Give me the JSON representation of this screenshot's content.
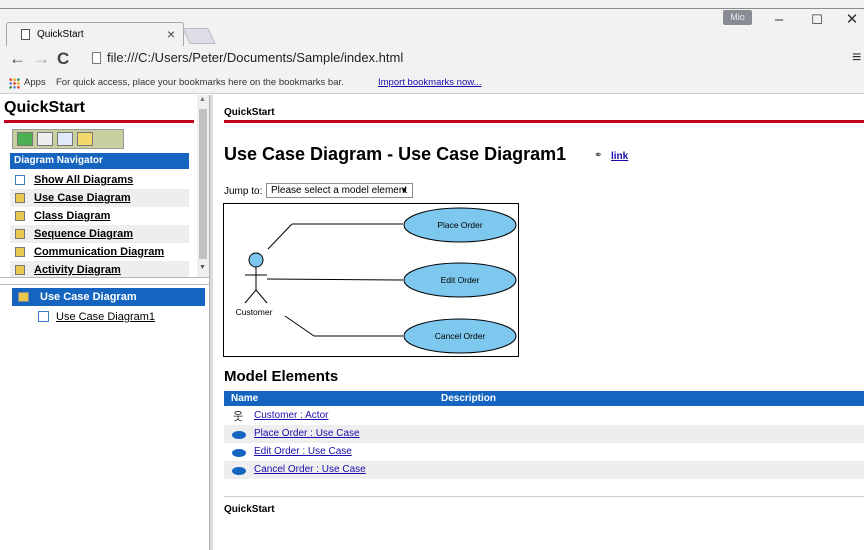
{
  "browser": {
    "tab_title": "QuickStart",
    "profile": "Mio",
    "url": "file:///C:/Users/Peter/Documents/Sample/index.html",
    "bookmarks": {
      "apps": "Apps",
      "info": "For quick access, place your bookmarks here on the bookmarks bar.",
      "import": "Import bookmarks now..."
    }
  },
  "sidebar": {
    "title": "QuickStart",
    "navigator": {
      "heading": "Diagram Navigator",
      "items": [
        {
          "label": "Show All Diagrams",
          "icon": "grid-icon"
        },
        {
          "label": "Use Case Diagram",
          "icon": "folder-icon"
        },
        {
          "label": "Class Diagram",
          "icon": "folder-icon"
        },
        {
          "label": "Sequence Diagram",
          "icon": "folder-icon"
        },
        {
          "label": "Communication Diagram",
          "icon": "folder-icon"
        },
        {
          "label": "Activity Diagram",
          "icon": "folder-icon"
        }
      ]
    },
    "tree": {
      "heading": "Use Case Diagram",
      "items": [
        {
          "label": "Use Case Diagram1"
        }
      ]
    }
  },
  "main": {
    "brand": "QuickStart",
    "heading": "Use Case Diagram - Use Case Diagram1",
    "link": "link",
    "jump_label": "Jump to:",
    "jump_select": "Please select a model element",
    "diagram": {
      "actor": "Customer",
      "use_cases": [
        "Place Order",
        "Edit Order",
        "Cancel Order"
      ]
    },
    "elements_title": "Model Elements",
    "table": {
      "columns": [
        "Name",
        "Description"
      ],
      "rows": [
        {
          "name": "Customer : Actor",
          "description": "",
          "icon": "actor-icon"
        },
        {
          "name": "Place Order : Use Case",
          "description": "",
          "icon": "use-case-icon"
        },
        {
          "name": "Edit Order : Use Case",
          "description": "",
          "icon": "use-case-icon"
        },
        {
          "name": "Cancel Order : Use Case",
          "description": "",
          "icon": "use-case-icon"
        }
      ]
    },
    "footer": "QuickStart"
  },
  "colors": {
    "accent_red": "#c2001e",
    "header_blue": "#1565c0",
    "use_case_fill": "#7ec8f0",
    "link_blue": "#1a0dab"
  }
}
